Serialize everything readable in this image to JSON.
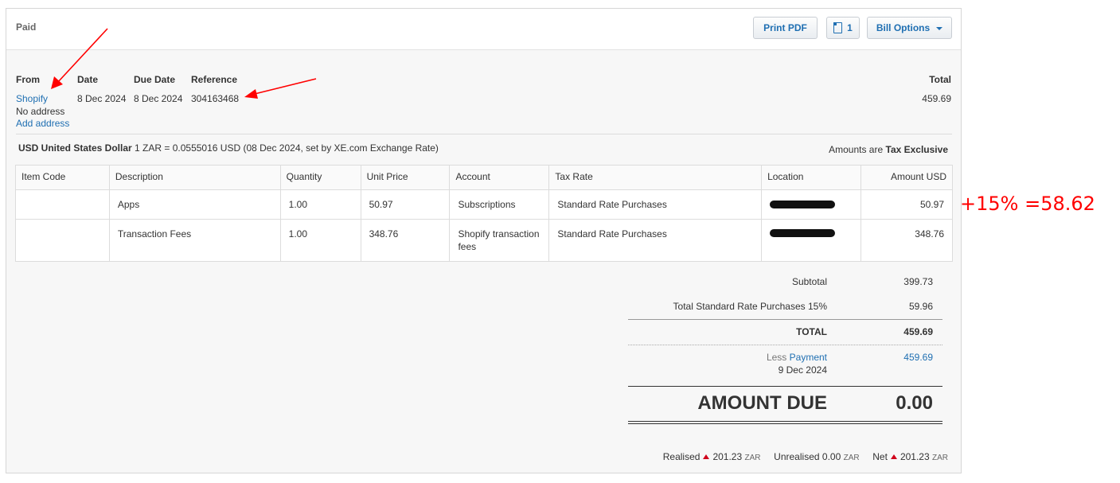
{
  "header": {
    "status": "Paid",
    "print_label": "Print PDF",
    "copies_count": "1",
    "options_label": "Bill Options"
  },
  "bill": {
    "from_label": "From",
    "date_label": "Date",
    "due_date_label": "Due Date",
    "reference_label": "Reference",
    "total_label": "Total",
    "from_name": "Shopify",
    "address_note": "No address",
    "add_address": "Add address",
    "date": "8 Dec 2024",
    "due_date": "8 Dec 2024",
    "reference": "304163468",
    "total": "459.69"
  },
  "currency": {
    "code_name": "USD United States Dollar",
    "rate_text": "1 ZAR = 0.0555016 USD (08 Dec 2024, set by XE.com Exchange Rate)",
    "amounts_are": "Amounts are",
    "tax_mode": "Tax Exclusive"
  },
  "table": {
    "columns": [
      "Item Code",
      "Description",
      "Quantity",
      "Unit Price",
      "Account",
      "Tax Rate",
      "Location",
      "Amount USD"
    ],
    "rows": [
      {
        "item_code": "",
        "description": "Apps",
        "quantity": "1.00",
        "unit_price": "50.97",
        "account": "Subscriptions",
        "tax_rate": "Standard Rate Purchases",
        "location": "[redacted]",
        "amount": "50.97"
      },
      {
        "item_code": "",
        "description": "Transaction Fees",
        "quantity": "1.00",
        "unit_price": "348.76",
        "account": "Shopify transaction fees",
        "tax_rate": "Standard Rate Purchases",
        "location": "[redacted]",
        "amount": "348.76"
      }
    ]
  },
  "totals": {
    "subtotal_label": "Subtotal",
    "subtotal": "399.73",
    "tax_label": "Total Standard Rate Purchases 15%",
    "tax": "59.96",
    "total_label": "TOTAL",
    "total": "459.69",
    "less_label": "Less",
    "payment_label": "Payment",
    "payment_date": "9 Dec 2024",
    "payment_amount": "459.69",
    "amount_due_label": "AMOUNT DUE",
    "amount_due": "0.00"
  },
  "footer": {
    "realised_label": "Realised",
    "realised_value": "201.23",
    "unrealised_label": "Unrealised",
    "unrealised_value": "0.00",
    "net_label": "Net",
    "net_value": "201.23",
    "unit": "ZAR"
  },
  "annotation": {
    "text": "+15% =58.62",
    "color": "#ff0000"
  },
  "colors": {
    "link": "#1f6fb2",
    "panel_bg": "#f7f7f7",
    "arrow": "#ff0000",
    "trend_up": "#d0021b"
  }
}
